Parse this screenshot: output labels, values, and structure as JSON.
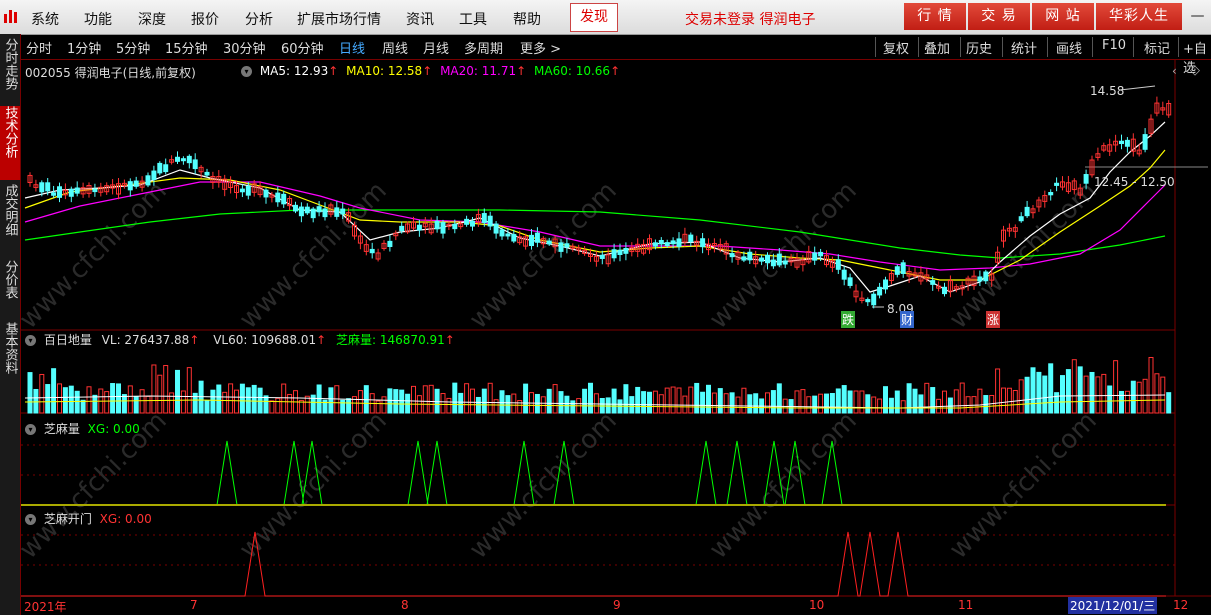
{
  "menubar": {
    "items": [
      "系统",
      "功能",
      "深度",
      "报价",
      "分析",
      "扩展市场行情",
      "资讯",
      "工具",
      "帮助"
    ],
    "discover": "发现",
    "login_status": "交易未登录 得润电子",
    "right_buttons": [
      "行 情",
      "交 易",
      "网 站",
      "华彩人生"
    ]
  },
  "sidebar": {
    "tabs": [
      "分时走势",
      "技术分析",
      "成交明细",
      "分价表",
      "基本资料"
    ],
    "active": "技术分析"
  },
  "periods": {
    "items": [
      "分时",
      "1分钟",
      "5分钟",
      "15分钟",
      "30分钟",
      "60分钟",
      "日线",
      "周线",
      "月线",
      "多周期",
      "更多 >"
    ],
    "active": "日线"
  },
  "tools": [
    "复权",
    "叠加",
    "历史",
    "统计",
    "画线",
    "F10",
    "标记",
    "+自选"
  ],
  "main_panel": {
    "title": "002055 得润电子(日线,前复权)",
    "ma5": "MA5: 12.93",
    "ma10": "MA10: 12.58",
    "ma20": "MA20: 11.71",
    "ma60": "MA60: 10.66",
    "high_label": "14.58",
    "range_label": "12.45 - 12.50",
    "low_label": "8.09",
    "tag_fall": "跌",
    "tag_finance": "财",
    "tag_rise": "涨"
  },
  "volume_panel": {
    "title": "百日地量",
    "vl": "VL: 276437.88",
    "vl60": "VL60: 109688.01",
    "zhima": "芝麻量: 146870.91"
  },
  "panel3": {
    "title": "芝麻量",
    "xg": "XG: 0.00"
  },
  "panel4": {
    "title": "芝麻开门",
    "xg": "XG: 0.00"
  },
  "xaxis": {
    "labels": [
      "2021年",
      "7",
      "8",
      "9",
      "10",
      "11"
    ],
    "current_date": "2021/12/01/三",
    "last_label": "12"
  },
  "colors": {
    "up": "#ff3232",
    "down": "#54ffff",
    "ma5": "#ffffff",
    "ma10": "#ffff00",
    "ma20": "#ff00ff",
    "ma60": "#00ff00",
    "grid": "#7a0000"
  }
}
